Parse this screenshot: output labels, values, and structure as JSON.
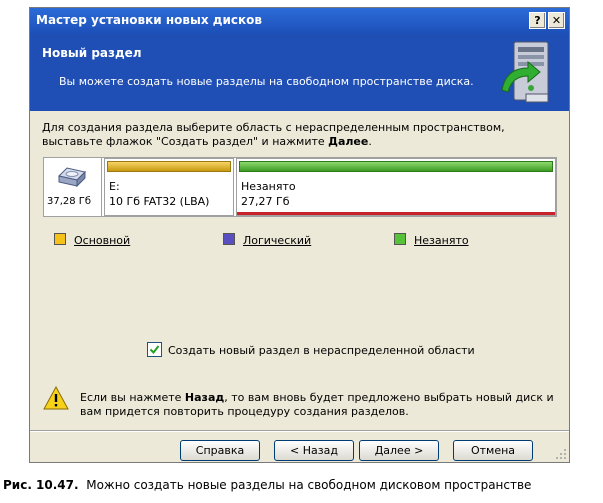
{
  "window": {
    "title": "Мастер установки новых дисков",
    "help_button": "?",
    "close_button": "✕"
  },
  "header": {
    "title": "Новый раздел",
    "subtitle": "Вы можете создать новые разделы на свободном пространстве диска."
  },
  "instructions": {
    "text": "Для создания раздела выберите область с нераспределенным пространством, выставьте флажок \"Создать раздел\" и нажмите ",
    "bold": "Далее",
    "tail": "."
  },
  "disk": {
    "size": "37,28 Гб",
    "partitions": [
      {
        "line1": "E:",
        "line2": "10 Гб  FAT32 (LBA)",
        "color": "#e7b72a"
      },
      {
        "line1": "Незанято",
        "line2": "27,27 Гб",
        "color": "#56b83a"
      }
    ]
  },
  "legend": [
    {
      "label": "Основной",
      "color": "#f4c21b"
    },
    {
      "label": "Логический",
      "color": "#5a4fc0"
    },
    {
      "label": "Незанято",
      "color": "#56c23a"
    }
  ],
  "checkbox": {
    "label": "Создать новый раздел в нераспределенной области",
    "checked": true
  },
  "warning": {
    "pre": "Если вы нажмете ",
    "bold": "Назад",
    "post": ", то вам вновь будет предложено выбрать новый диск и вам придется повторить процедуру создания разделов."
  },
  "buttons": {
    "help": "Справка",
    "back": "< Назад",
    "next": "Далее >",
    "cancel": "Отмена"
  },
  "caption": {
    "number": "Рис. 10.47.",
    "text": "Можно создать новые разделы на свободном дисковом пространстве"
  }
}
